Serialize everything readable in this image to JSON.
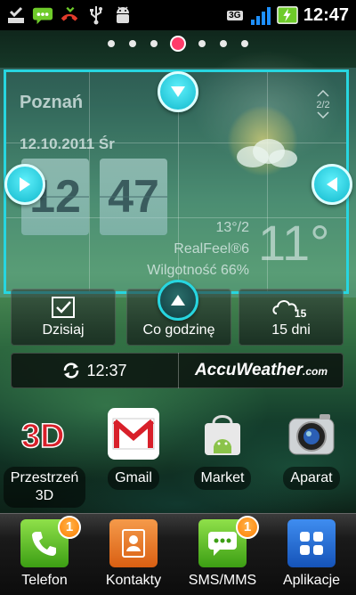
{
  "status_bar": {
    "left_icons": [
      "download-check-icon",
      "sms-icon",
      "missed-call-icon",
      "usb-icon",
      "android-debug-icon"
    ],
    "network": "3G",
    "time": "12:47"
  },
  "home_pages": {
    "count": 7,
    "current": 4
  },
  "weather": {
    "city": "Poznań",
    "date": "12.10.2011 Śr",
    "page_indicator": "2/2",
    "clock_hours": "12",
    "clock_minutes": "47",
    "temp_range": "13°/2",
    "real_feel": "RealFeel®6",
    "humidity": "Wilgotność 66%",
    "current_temp": "11°"
  },
  "forecast_buttons": [
    {
      "label": "Dzisiaj",
      "icon": "calendar-check-icon"
    },
    {
      "label": "Co godzinę",
      "icon": "collapse-arrow-icon"
    },
    {
      "label": "15 dni",
      "icon": "cloud-15-icon",
      "badge": "15"
    }
  ],
  "refresh": {
    "time": "12:37",
    "brand": "AccuWeather",
    "brand_suffix": ".com"
  },
  "apps": [
    {
      "label_line1": "Przestrzeń",
      "label_line2": "3D",
      "icon": "3d-space-icon"
    },
    {
      "label_line1": "Gmail",
      "icon": "gmail-icon"
    },
    {
      "label_line1": "Market",
      "icon": "market-bag-icon"
    },
    {
      "label_line1": "Aparat",
      "icon": "camera-icon"
    }
  ],
  "dock": [
    {
      "label": "Telefon",
      "icon": "phone-icon",
      "badge": "1"
    },
    {
      "label": "Kontakty",
      "icon": "contacts-icon"
    },
    {
      "label": "SMS/MMS",
      "icon": "sms-mms-icon",
      "badge": "1"
    },
    {
      "label": "Aplikacje",
      "icon": "apps-grid-icon"
    }
  ],
  "colors": {
    "accent": "#27d6e0",
    "page_dot_active": "#ff3c6a",
    "badge": "#ff8a00"
  }
}
